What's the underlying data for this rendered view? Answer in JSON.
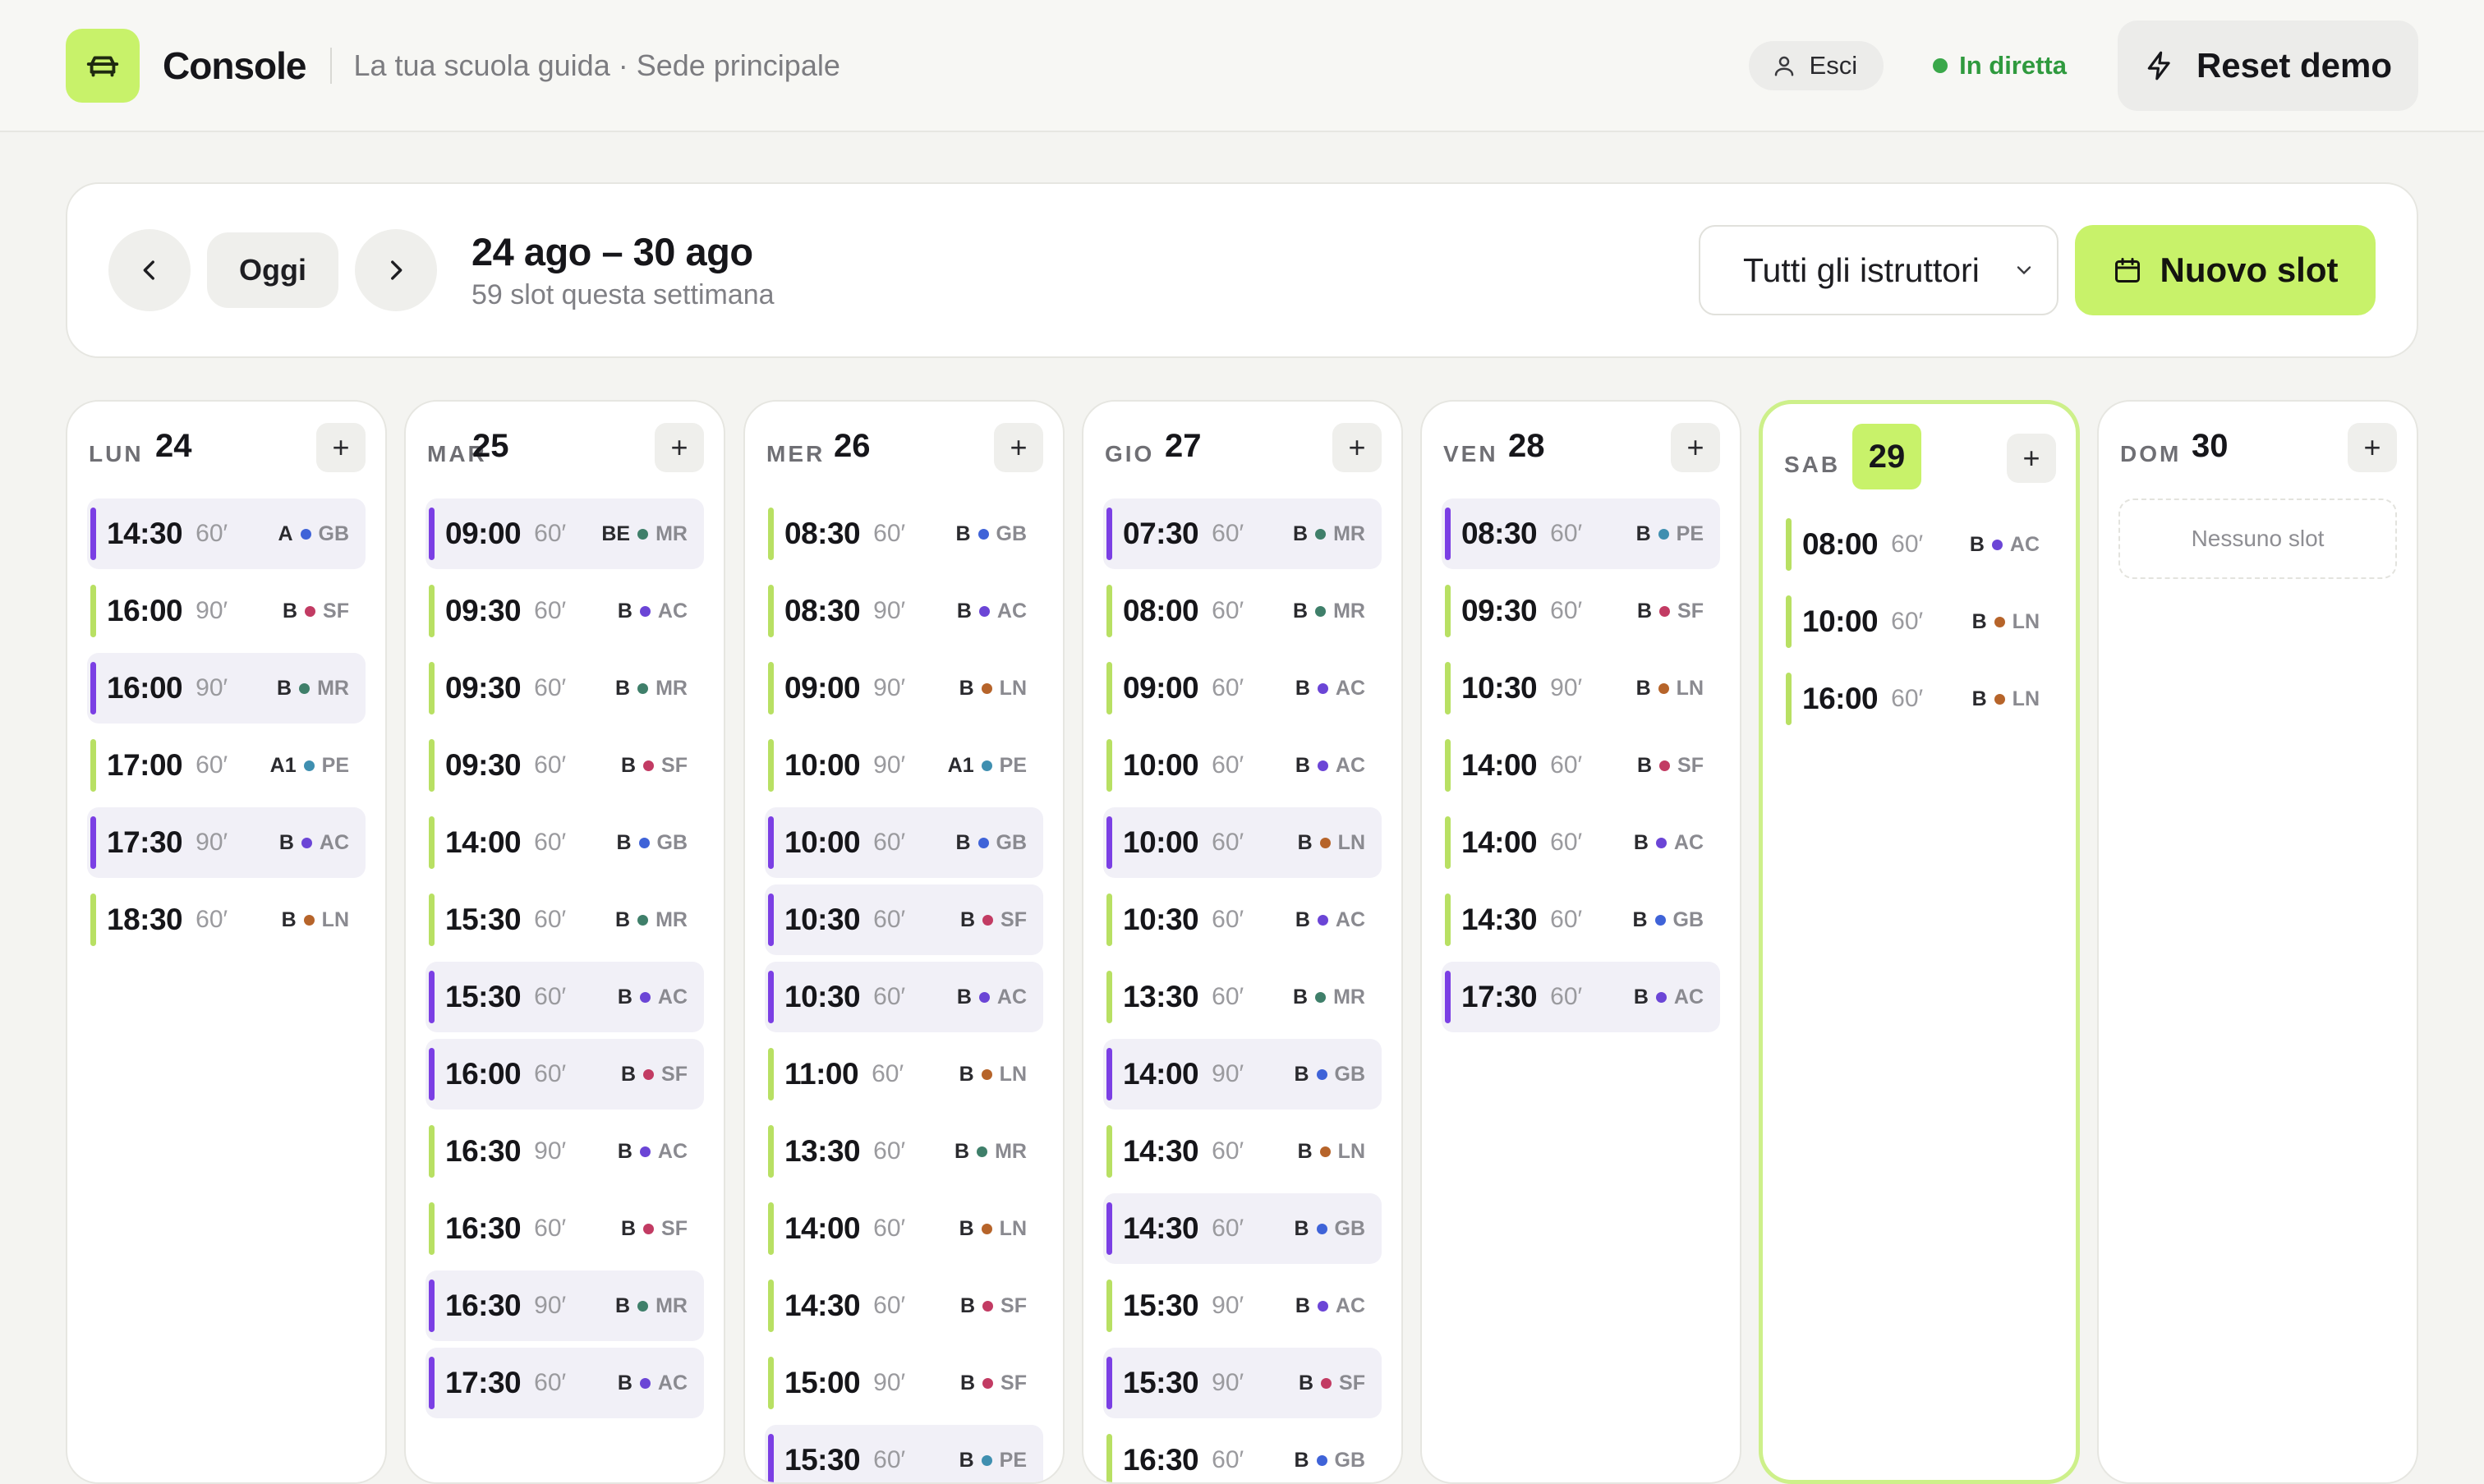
{
  "header": {
    "brand": "Console",
    "subtitle": "La tua scuola guida · Sede principale",
    "logout_label": "Esci",
    "live_label": "In diretta",
    "reset_label": "Reset demo"
  },
  "toolbar": {
    "today_label": "Oggi",
    "range_title": "24 ago – 30 ago",
    "range_sub": "59 slot questa settimana",
    "instructor_filter": "Tutti gli istruttori",
    "new_slot_label": "Nuovo slot"
  },
  "colors": {
    "accent": "#c8f26a",
    "booked_bar": "#7b3fe4",
    "free_bar": "#b8e063",
    "instructors": {
      "GB": "#3f63d8",
      "SF": "#c23b63",
      "MR": "#3f7f6a",
      "AC": "#6b45d6",
      "PE": "#3f8fb0",
      "LN": "#b6642a"
    }
  },
  "week": {
    "empty_label": "Nessuno slot",
    "add_label": "+",
    "days": [
      {
        "dow": "LUN",
        "num": "24",
        "slots": [
          {
            "time": "14:30",
            "dur": "60′",
            "lic": "A",
            "ini": "GB",
            "booked": true
          },
          {
            "time": "16:00",
            "dur": "90′",
            "lic": "B",
            "ini": "SF",
            "booked": false
          },
          {
            "time": "16:00",
            "dur": "90′",
            "lic": "B",
            "ini": "MR",
            "booked": true
          },
          {
            "time": "17:00",
            "dur": "60′",
            "lic": "A1",
            "ini": "PE",
            "booked": false
          },
          {
            "time": "17:30",
            "dur": "90′",
            "lic": "B",
            "ini": "AC",
            "booked": true
          },
          {
            "time": "18:30",
            "dur": "60′",
            "lic": "B",
            "ini": "LN",
            "booked": false
          }
        ]
      },
      {
        "dow": "MAR",
        "num": "25",
        "slots": [
          {
            "time": "09:00",
            "dur": "60′",
            "lic": "BE",
            "ini": "MR",
            "booked": true
          },
          {
            "time": "09:30",
            "dur": "60′",
            "lic": "B",
            "ini": "AC",
            "booked": false
          },
          {
            "time": "09:30",
            "dur": "60′",
            "lic": "B",
            "ini": "MR",
            "booked": false
          },
          {
            "time": "09:30",
            "dur": "60′",
            "lic": "B",
            "ini": "SF",
            "booked": false
          },
          {
            "time": "14:00",
            "dur": "60′",
            "lic": "B",
            "ini": "GB",
            "booked": false
          },
          {
            "time": "15:30",
            "dur": "60′",
            "lic": "B",
            "ini": "MR",
            "booked": false
          },
          {
            "time": "15:30",
            "dur": "60′",
            "lic": "B",
            "ini": "AC",
            "booked": true
          },
          {
            "time": "16:00",
            "dur": "60′",
            "lic": "B",
            "ini": "SF",
            "booked": true
          },
          {
            "time": "16:30",
            "dur": "90′",
            "lic": "B",
            "ini": "AC",
            "booked": false
          },
          {
            "time": "16:30",
            "dur": "60′",
            "lic": "B",
            "ini": "SF",
            "booked": false
          },
          {
            "time": "16:30",
            "dur": "90′",
            "lic": "B",
            "ini": "MR",
            "booked": true
          },
          {
            "time": "17:30",
            "dur": "60′",
            "lic": "B",
            "ini": "AC",
            "booked": true
          }
        ]
      },
      {
        "dow": "MER",
        "num": "26",
        "slots": [
          {
            "time": "08:30",
            "dur": "60′",
            "lic": "B",
            "ini": "GB",
            "booked": false
          },
          {
            "time": "08:30",
            "dur": "90′",
            "lic": "B",
            "ini": "AC",
            "booked": false
          },
          {
            "time": "09:00",
            "dur": "90′",
            "lic": "B",
            "ini": "LN",
            "booked": false
          },
          {
            "time": "10:00",
            "dur": "90′",
            "lic": "A1",
            "ini": "PE",
            "booked": false
          },
          {
            "time": "10:00",
            "dur": "60′",
            "lic": "B",
            "ini": "GB",
            "booked": true
          },
          {
            "time": "10:30",
            "dur": "60′",
            "lic": "B",
            "ini": "SF",
            "booked": true
          },
          {
            "time": "10:30",
            "dur": "60′",
            "lic": "B",
            "ini": "AC",
            "booked": true
          },
          {
            "time": "11:00",
            "dur": "60′",
            "lic": "B",
            "ini": "LN",
            "booked": false
          },
          {
            "time": "13:30",
            "dur": "60′",
            "lic": "B",
            "ini": "MR",
            "booked": false
          },
          {
            "time": "14:00",
            "dur": "60′",
            "lic": "B",
            "ini": "LN",
            "booked": false
          },
          {
            "time": "14:30",
            "dur": "60′",
            "lic": "B",
            "ini": "SF",
            "booked": false
          },
          {
            "time": "15:00",
            "dur": "90′",
            "lic": "B",
            "ini": "SF",
            "booked": false
          },
          {
            "time": "15:30",
            "dur": "60′",
            "lic": "B",
            "ini": "PE",
            "booked": true
          }
        ]
      },
      {
        "dow": "GIO",
        "num": "27",
        "slots": [
          {
            "time": "07:30",
            "dur": "60′",
            "lic": "B",
            "ini": "MR",
            "booked": true
          },
          {
            "time": "08:00",
            "dur": "60′",
            "lic": "B",
            "ini": "MR",
            "booked": false
          },
          {
            "time": "09:00",
            "dur": "60′",
            "lic": "B",
            "ini": "AC",
            "booked": false
          },
          {
            "time": "10:00",
            "dur": "60′",
            "lic": "B",
            "ini": "AC",
            "booked": false
          },
          {
            "time": "10:00",
            "dur": "60′",
            "lic": "B",
            "ini": "LN",
            "booked": true
          },
          {
            "time": "10:30",
            "dur": "60′",
            "lic": "B",
            "ini": "AC",
            "booked": false
          },
          {
            "time": "13:30",
            "dur": "60′",
            "lic": "B",
            "ini": "MR",
            "booked": false
          },
          {
            "time": "14:00",
            "dur": "90′",
            "lic": "B",
            "ini": "GB",
            "booked": true
          },
          {
            "time": "14:30",
            "dur": "60′",
            "lic": "B",
            "ini": "LN",
            "booked": false
          },
          {
            "time": "14:30",
            "dur": "60′",
            "lic": "B",
            "ini": "GB",
            "booked": true
          },
          {
            "time": "15:30",
            "dur": "90′",
            "lic": "B",
            "ini": "AC",
            "booked": false
          },
          {
            "time": "15:30",
            "dur": "90′",
            "lic": "B",
            "ini": "SF",
            "booked": true
          },
          {
            "time": "16:30",
            "dur": "60′",
            "lic": "B",
            "ini": "GB",
            "booked": false
          }
        ]
      },
      {
        "dow": "VEN",
        "num": "28",
        "slots": [
          {
            "time": "08:30",
            "dur": "60′",
            "lic": "B",
            "ini": "PE",
            "booked": true
          },
          {
            "time": "09:30",
            "dur": "60′",
            "lic": "B",
            "ini": "SF",
            "booked": false
          },
          {
            "time": "10:30",
            "dur": "90′",
            "lic": "B",
            "ini": "LN",
            "booked": false
          },
          {
            "time": "14:00",
            "dur": "60′",
            "lic": "B",
            "ini": "SF",
            "booked": false
          },
          {
            "time": "14:00",
            "dur": "60′",
            "lic": "B",
            "ini": "AC",
            "booked": false
          },
          {
            "time": "14:30",
            "dur": "60′",
            "lic": "B",
            "ini": "GB",
            "booked": false
          },
          {
            "time": "17:30",
            "dur": "60′",
            "lic": "B",
            "ini": "AC",
            "booked": true
          }
        ]
      },
      {
        "dow": "SAB",
        "num": "29",
        "today": true,
        "slots": [
          {
            "time": "08:00",
            "dur": "60′",
            "lic": "B",
            "ini": "AC",
            "booked": false
          },
          {
            "time": "10:00",
            "dur": "60′",
            "lic": "B",
            "ini": "LN",
            "booked": false
          },
          {
            "time": "16:00",
            "dur": "60′",
            "lic": "B",
            "ini": "LN",
            "booked": false
          }
        ]
      },
      {
        "dow": "DOM",
        "num": "30",
        "slots": []
      }
    ]
  }
}
